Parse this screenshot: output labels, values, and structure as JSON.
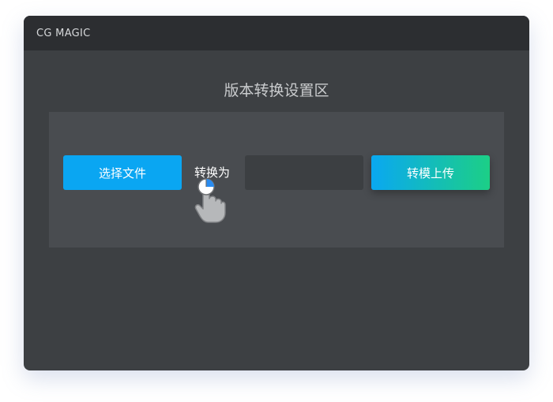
{
  "window": {
    "title": "CG MAGIC"
  },
  "section": {
    "title": "版本转换设置区"
  },
  "controls": {
    "select_file_label": "选择文件",
    "convert_to_label": "转换为",
    "format_select_value": "",
    "upload_label": "转模上传"
  },
  "cursor": {
    "icon": "hand-pointer-icon"
  },
  "colors": {
    "select_button": "#0aa6f2",
    "upload_gradient_start": "#0aa8f1",
    "upload_gradient_end": "#1ccf86",
    "panel": "#494c50",
    "window": "#3d4043",
    "titlebar": "#2c2e31"
  }
}
